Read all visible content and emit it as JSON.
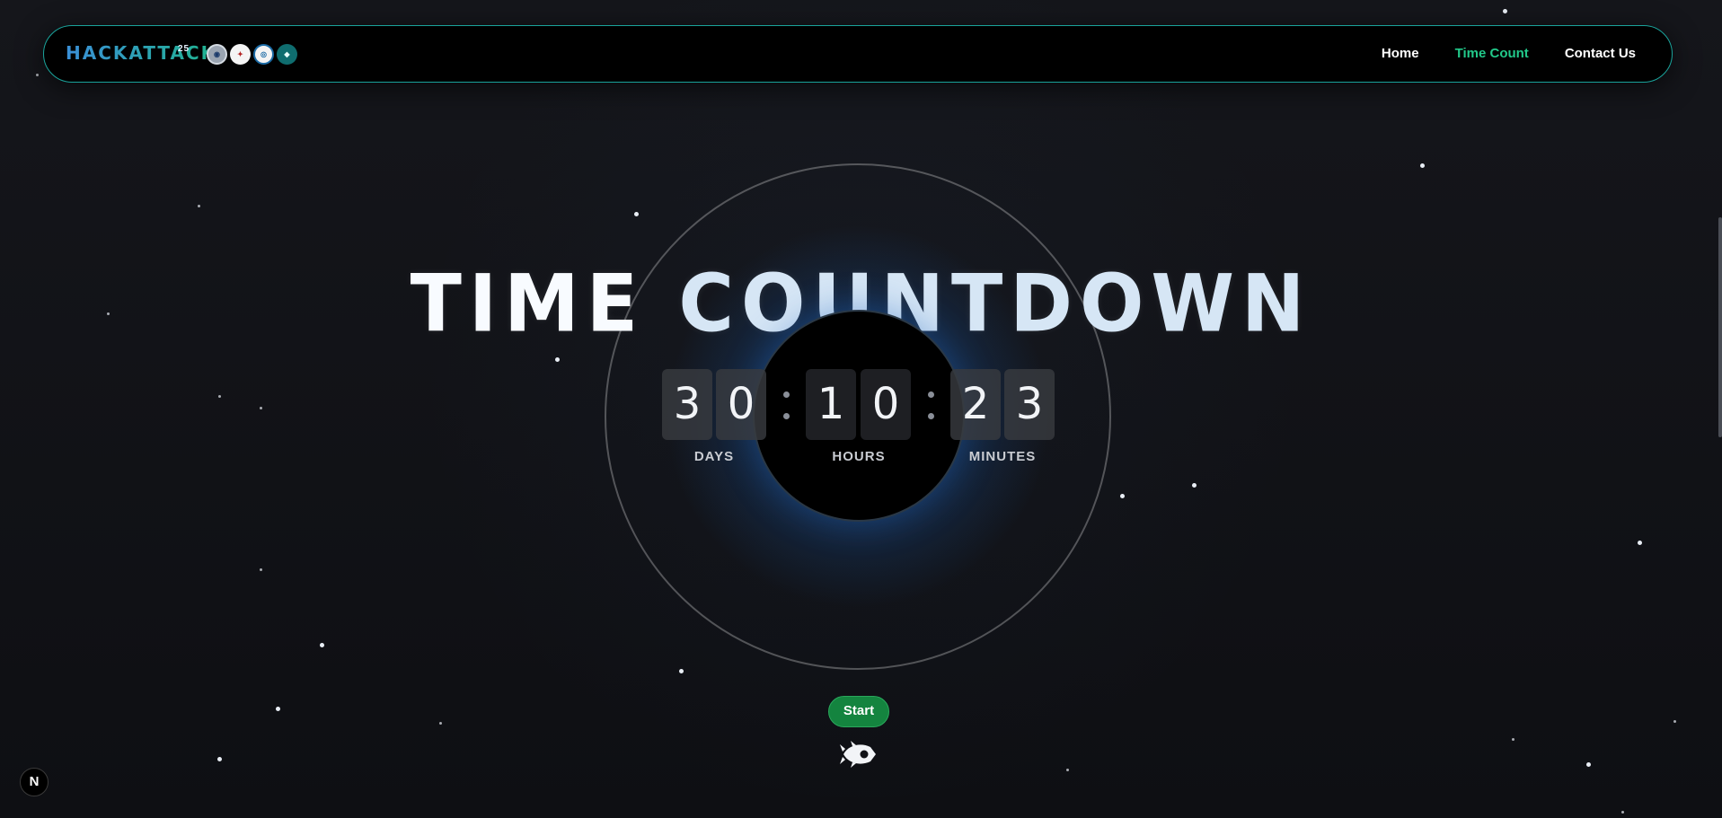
{
  "nav": {
    "brand": "HACKATTACK",
    "brand_sup": "25",
    "partner_logos": [
      "logo-1",
      "logo-2",
      "logo-3",
      "logo-4"
    ],
    "links": [
      {
        "label": "Home",
        "active": false
      },
      {
        "label": "Time Count",
        "active": true
      },
      {
        "label": "Contact Us",
        "active": false
      }
    ],
    "active_color": "#22c98a",
    "border_color": "#1aa39b"
  },
  "hero": {
    "title_part1": "TIME",
    "title_part2": "COUNTDOWN",
    "days": {
      "d1": "3",
      "d2": "0",
      "label": "DAYS"
    },
    "hours": {
      "d1": "1",
      "d2": "0",
      "label": "HOURS"
    },
    "minutes": {
      "d1": "2",
      "d2": "3",
      "label": "MINUTES"
    },
    "glow_color": "#2878d2"
  },
  "start_button": {
    "label": "Start",
    "color": "#14843f"
  },
  "rocket_icon": "rocket-icon",
  "dev_badge": {
    "label": "N"
  }
}
